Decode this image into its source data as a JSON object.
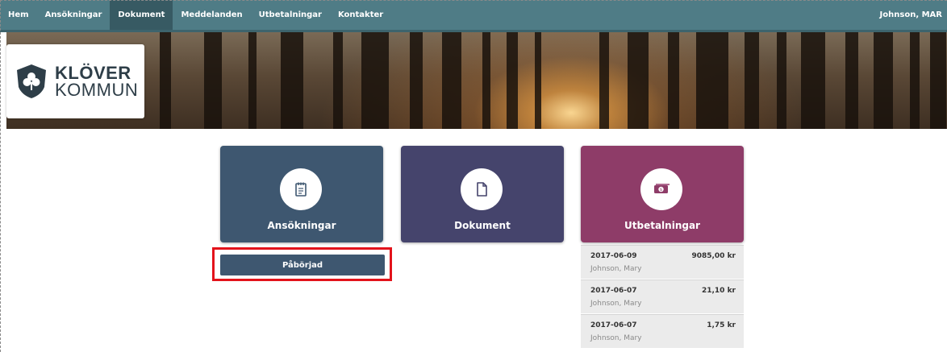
{
  "nav": {
    "items": [
      {
        "label": "Hem"
      },
      {
        "label": "Ansökningar"
      },
      {
        "label": "Dokument"
      },
      {
        "label": "Meddelanden"
      },
      {
        "label": "Utbetalningar"
      },
      {
        "label": "Kontakter"
      }
    ],
    "active_index": 2,
    "user": "Johnson, MAR"
  },
  "logo": {
    "line1": "KLÖVER",
    "line2": "KOMMUN"
  },
  "tiles": [
    {
      "label": "Ansökningar",
      "icon": "notepad-icon",
      "color": "#3e5770"
    },
    {
      "label": "Dokument",
      "icon": "document-icon",
      "color": "#45446c"
    },
    {
      "label": "Utbetalningar",
      "icon": "money-icon",
      "color": "#8e3c68"
    }
  ],
  "applications": {
    "status_label": "Påbörjad"
  },
  "payments": [
    {
      "date": "2017-06-09",
      "amount": "9085,00 kr",
      "name": "Johnson, Mary"
    },
    {
      "date": "2017-06-07",
      "amount": "21,10 kr",
      "name": "Johnson, Mary"
    },
    {
      "date": "2017-06-07",
      "amount": "1,75 kr",
      "name": "Johnson, Mary"
    }
  ],
  "colors": {
    "nav_bg": "#4f7c86",
    "highlight": "#e3131b"
  }
}
